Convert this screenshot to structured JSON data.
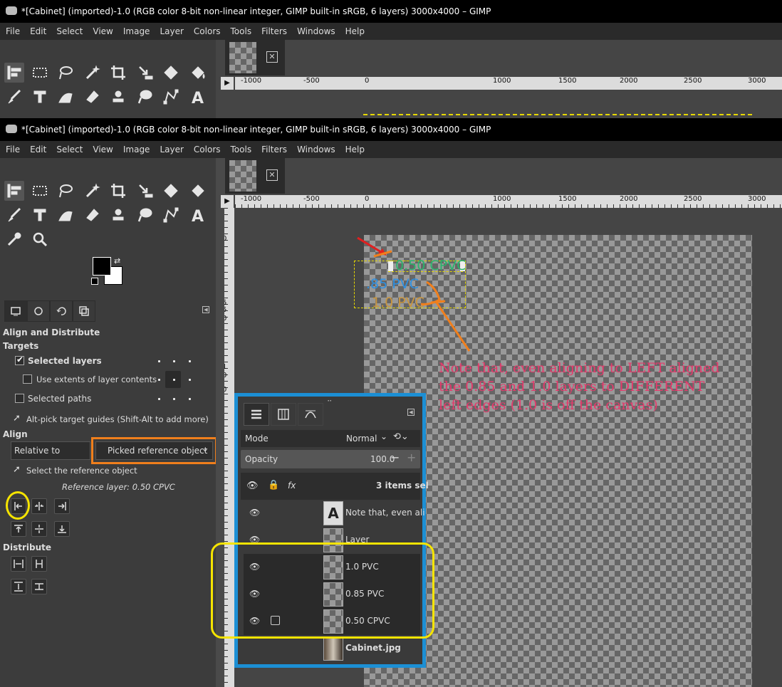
{
  "window_title": "*[Cabinet] (imported)-1.0 (RGB color 8-bit non-linear integer, GIMP built-in sRGB, 6 layers) 3000x4000 – GIMP",
  "menu": [
    "File",
    "Edit",
    "Select",
    "View",
    "Image",
    "Layer",
    "Colors",
    "Tools",
    "Filters",
    "Windows",
    "Help"
  ],
  "ruler_labels": [
    "-1000",
    "-500",
    "0",
    "1000",
    "1500",
    "2000",
    "2500",
    "3000"
  ],
  "vruler_labels": [
    "0",
    "5",
    "5",
    "0",
    "1",
    "0",
    "0"
  ],
  "canvas_text": {
    "t050": "0.50 CPVC",
    "t085": ".85 PVC",
    "t10": "1.0 PVC"
  },
  "annotation": {
    "line1": "Note that, even aligning to LEFT aligned",
    "line2": "the 0.85 and 1.0 layers to DIFFERENT",
    "line3": "left edges (1.0 is off the canvas)"
  },
  "align_panel": {
    "title": "Align and Distribute",
    "targets_heading": "Targets",
    "selected_layers": "Selected layers",
    "use_extents": "Use extents of layer contents",
    "selected_paths": "Selected paths",
    "alt_pick": "Alt-pick target guides (Shift-Alt to add more)",
    "align_heading": "Align",
    "relative_to": "Relative to",
    "relative_value": "Picked reference object",
    "select_ref": "Select the reference object",
    "reference_layer": "Reference layer: 0.50 CPVC",
    "distribute_heading": "Distribute"
  },
  "layers_panel": {
    "mode_label": "Mode",
    "mode_value": "Normal",
    "opacity_label": "Opacity",
    "opacity_value": "100.0",
    "items_selected": "3 items sel",
    "layers": [
      {
        "name": "Note that, even align"
      },
      {
        "name": "Layer"
      },
      {
        "name": "1.0 PVC"
      },
      {
        "name": "0.85 PVC"
      },
      {
        "name": "0.50 CPVC"
      },
      {
        "name": "Cabinet.jpg"
      }
    ]
  },
  "colors": {
    "highlight_yellow": "#f5e400",
    "highlight_orange": "#f07f1c",
    "highlight_blue": "#1c8fd4",
    "annotation": "#e53a6c"
  }
}
